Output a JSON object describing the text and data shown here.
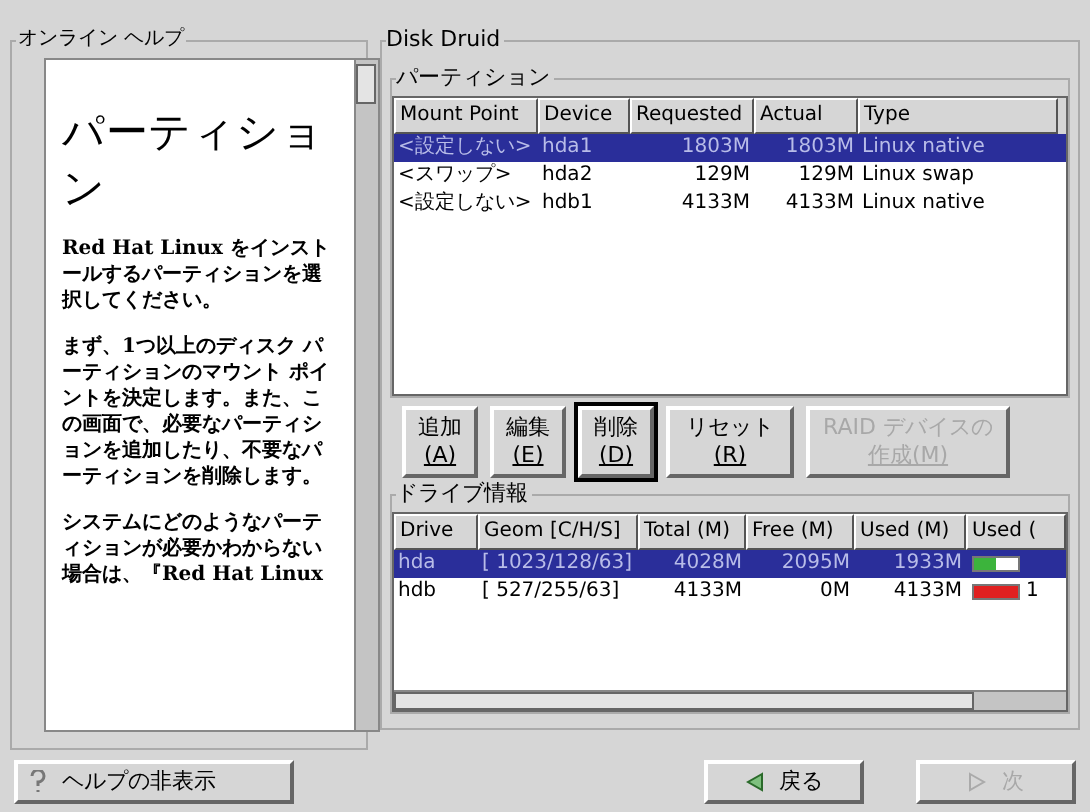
{
  "help": {
    "title": "オンライン ヘルプ",
    "heading": "パーティション",
    "paragraphs": [
      "Red Hat Linux をインストールするパーティションを選択してください。",
      "まず、1つ以上のディスク パーティションのマウント ポイントを決定します。また、この画面で、必要なパーティションを追加したり、不要なパーティションを削除します。",
      "システムにどのようなパーティションが必要かわからない場合は、『Red Hat Linux"
    ]
  },
  "disk_druid": {
    "title": "Disk Druid",
    "partitions": {
      "title": "パーティション",
      "columns": [
        "Mount Point",
        "Device",
        "Requested",
        "Actual",
        "Type"
      ],
      "rows": [
        {
          "selected": true,
          "cells": [
            "<設定しない>",
            "hda1",
            "1803M",
            "1803M",
            "Linux native"
          ]
        },
        {
          "selected": false,
          "cells": [
            "<スワップ>",
            "hda2",
            "129M",
            "129M",
            "Linux swap"
          ]
        },
        {
          "selected": false,
          "cells": [
            "<設定しない>",
            "hdb1",
            "4133M",
            "4133M",
            "Linux native"
          ]
        }
      ]
    },
    "buttons": [
      {
        "label": "追加",
        "mnemonic": "(A)",
        "disabled": false,
        "focused": false
      },
      {
        "label": "編集",
        "mnemonic": "(E)",
        "disabled": false,
        "focused": false
      },
      {
        "label": "削除",
        "mnemonic": "(D)",
        "disabled": false,
        "focused": true
      },
      {
        "label": "リセット",
        "mnemonic": "(R)",
        "disabled": false,
        "focused": false
      },
      {
        "label": "RAID デバイスの",
        "mnemonic": "作成(M)",
        "disabled": true,
        "focused": false
      }
    ],
    "drives": {
      "title": "ドライブ情報",
      "columns": [
        "Drive",
        "Geom [C/H/S]",
        "Total (M)",
        "Free (M)",
        "Used (M)",
        "Used ("
      ],
      "rows": [
        {
          "selected": true,
          "cells": [
            "hda",
            "[ 1023/128/63]",
            "4028M",
            "2095M",
            "1933M"
          ],
          "level": 0.48,
          "color": "#3cb43c"
        },
        {
          "selected": false,
          "cells": [
            "hdb",
            "[ 527/255/63]",
            "4133M",
            "0M",
            "4133M"
          ],
          "level": 1,
          "color": "#e02020",
          "reading": "1"
        }
      ]
    }
  },
  "footer": {
    "help_button": "ヘルプの非表示",
    "back_button": "戻る",
    "next_button": "次",
    "next_disabled": true
  }
}
